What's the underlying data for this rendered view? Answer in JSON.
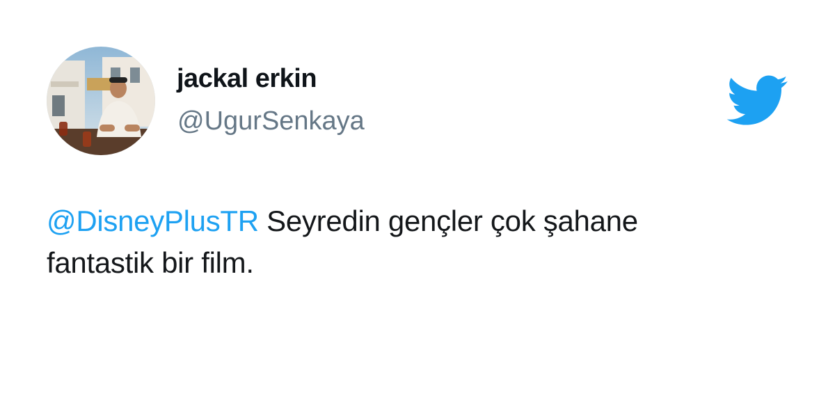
{
  "author": {
    "display_name": "jackal erkin",
    "handle": "@UgurSenkaya"
  },
  "tweet": {
    "mention": "@DisneyPlusTR",
    "text_line1": " Seyredin gençler çok şahane",
    "text_line2": "fantastik bir film."
  },
  "icons": {
    "logo": "twitter-bird-icon",
    "avatar": "profile-photo"
  },
  "colors": {
    "brand_blue": "#1da1f2",
    "handle_gray": "#657786",
    "text": "#14171a"
  }
}
